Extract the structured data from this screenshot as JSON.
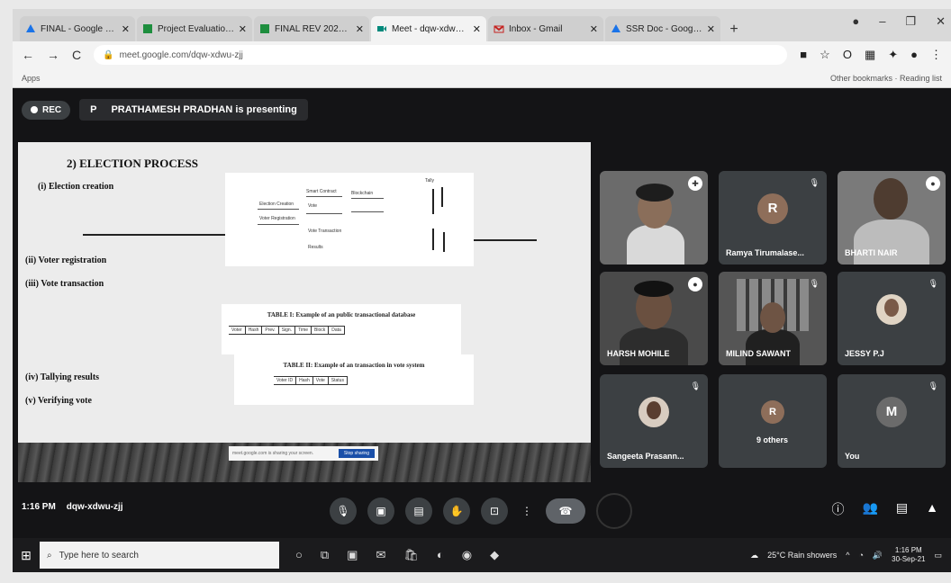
{
  "browser": {
    "tabs": [
      {
        "label": "FINAL - Google Drive",
        "icon": "drive-icon",
        "color": "#1a73e8"
      },
      {
        "label": "Project Evaluation Sheet",
        "icon": "sheets-icon",
        "color": "#1e8e3e"
      },
      {
        "label": "FINAL REV 2020-21",
        "icon": "sheets-icon",
        "color": "#1e8e3e"
      },
      {
        "label": "Meet - dqw-xdwu-zjj",
        "icon": "meet-icon",
        "color": "#00897b"
      },
      {
        "label": "Inbox - Gmail",
        "icon": "mail-icon",
        "color": "#c5221f"
      },
      {
        "label": "SSR Doc - Google Drive",
        "icon": "drive-icon",
        "color": "#1a73e8"
      }
    ],
    "new_tab": "+",
    "url": "meet.google.com/dqw-xdwu-zjj",
    "bookmark_left": "Apps",
    "bookmark_right": "Other bookmarks  ·  Reading list"
  },
  "meet": {
    "rec_label": "REC",
    "presenter_initial": "P",
    "presenter_text": "PRATHAMESH PRADHAN is presenting",
    "time": "1:16 PM",
    "meeting_code": "dqw-xdwu-zjj",
    "participants": [
      {
        "name": "",
        "kind": "video"
      },
      {
        "name": "Ramya Tirumalase...",
        "kind": "avatar",
        "initial": "R",
        "color": "#8e6e5a"
      },
      {
        "name": "BHARTI NAIR",
        "kind": "video"
      },
      {
        "name": "HARSH MOHILE",
        "kind": "video"
      },
      {
        "name": "MILIND SAWANT",
        "kind": "video"
      },
      {
        "name": "JESSY P.J",
        "kind": "photo"
      },
      {
        "name": "Sangeeta Prasann...",
        "kind": "photo"
      },
      {
        "name": "9 others",
        "kind": "group",
        "initial": "R"
      },
      {
        "name": "You",
        "kind": "avatar",
        "initial": "M",
        "color": "#6b6b6b"
      }
    ]
  },
  "slide": {
    "title": "2) ELECTION PROCESS",
    "items": [
      "(i)  Election creation",
      "(ii) Voter registration",
      "(iii) Vote transaction",
      "(iv) Tallying results",
      "(v) Verifying vote"
    ],
    "diagram": {
      "labels": [
        "Election Creation",
        "Voter Registration",
        "Vote Transaction",
        "Smart Contract",
        "Blockchain",
        "Tally",
        "Vote",
        "Results"
      ]
    },
    "table1": {
      "caption": "TABLE I: Example of an public transactional database",
      "headers": [
        "Voter",
        "Hash",
        "Prev.",
        "Sign.",
        "Time",
        "Block",
        "Data"
      ]
    },
    "table2": {
      "caption": "TABLE II: Example of an transaction in vote system",
      "headers": [
        "Voter ID",
        "Hash",
        "Vote",
        "Status"
      ]
    },
    "minibar_text": "meet.google.com is sharing your screen.",
    "minibar_button": "Stop sharing"
  },
  "taskbar": {
    "search_placeholder": "Type here to search",
    "weather": "25°C  Rain showers",
    "clock_time": "1:16 PM",
    "clock_date": "30-Sep-21"
  }
}
